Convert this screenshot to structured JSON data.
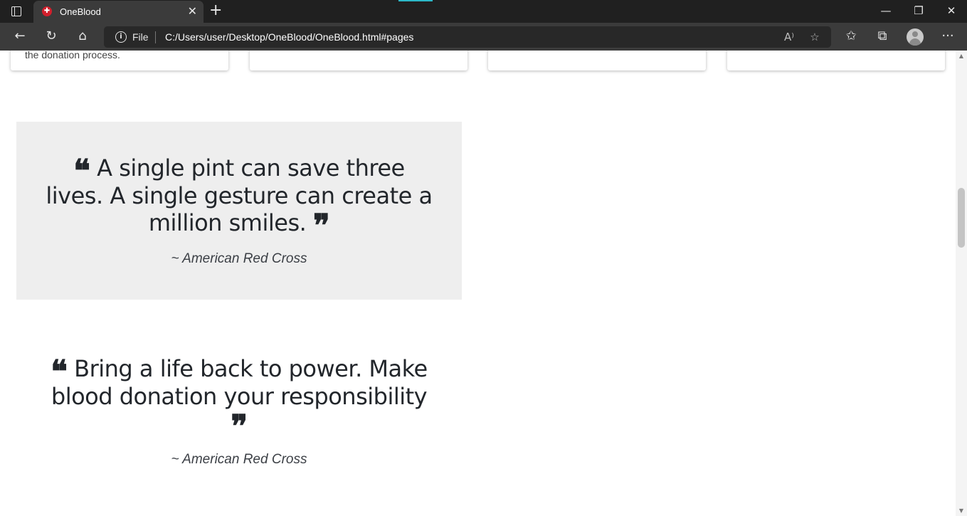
{
  "browser": {
    "tab_title": "OneBlood",
    "tab_favicon": "✚",
    "new_tab": "+",
    "close_tab": "✕",
    "window": {
      "minimize": "—",
      "restore": "❐",
      "close": "✕"
    },
    "nav": {
      "back": "←",
      "refresh": "↻",
      "home": "⌂"
    },
    "address": {
      "info": "i",
      "scheme_label": "File",
      "url": "C:/Users/user/Desktop/OneBlood/OneBlood.html#pages",
      "read_aloud": "A⁾",
      "add_favorite": "☆"
    },
    "toolbar": {
      "favorites": "✩",
      "collections": "⧉",
      "more": "···"
    }
  },
  "page": {
    "card_snippet": "the donation process.",
    "quotes": [
      {
        "open_mark": "❝",
        "text": "A single pint can save three lives. A single gesture can create a million smiles.",
        "close_mark": "❞",
        "author": "~ American Red Cross"
      },
      {
        "open_mark": "❝",
        "text": "Bring a life back to power. Make blood donation your responsibility",
        "close_mark": "❞",
        "author": "~ American Red Cross"
      }
    ]
  },
  "scrollbar": {
    "up": "▲",
    "down": "▼"
  }
}
